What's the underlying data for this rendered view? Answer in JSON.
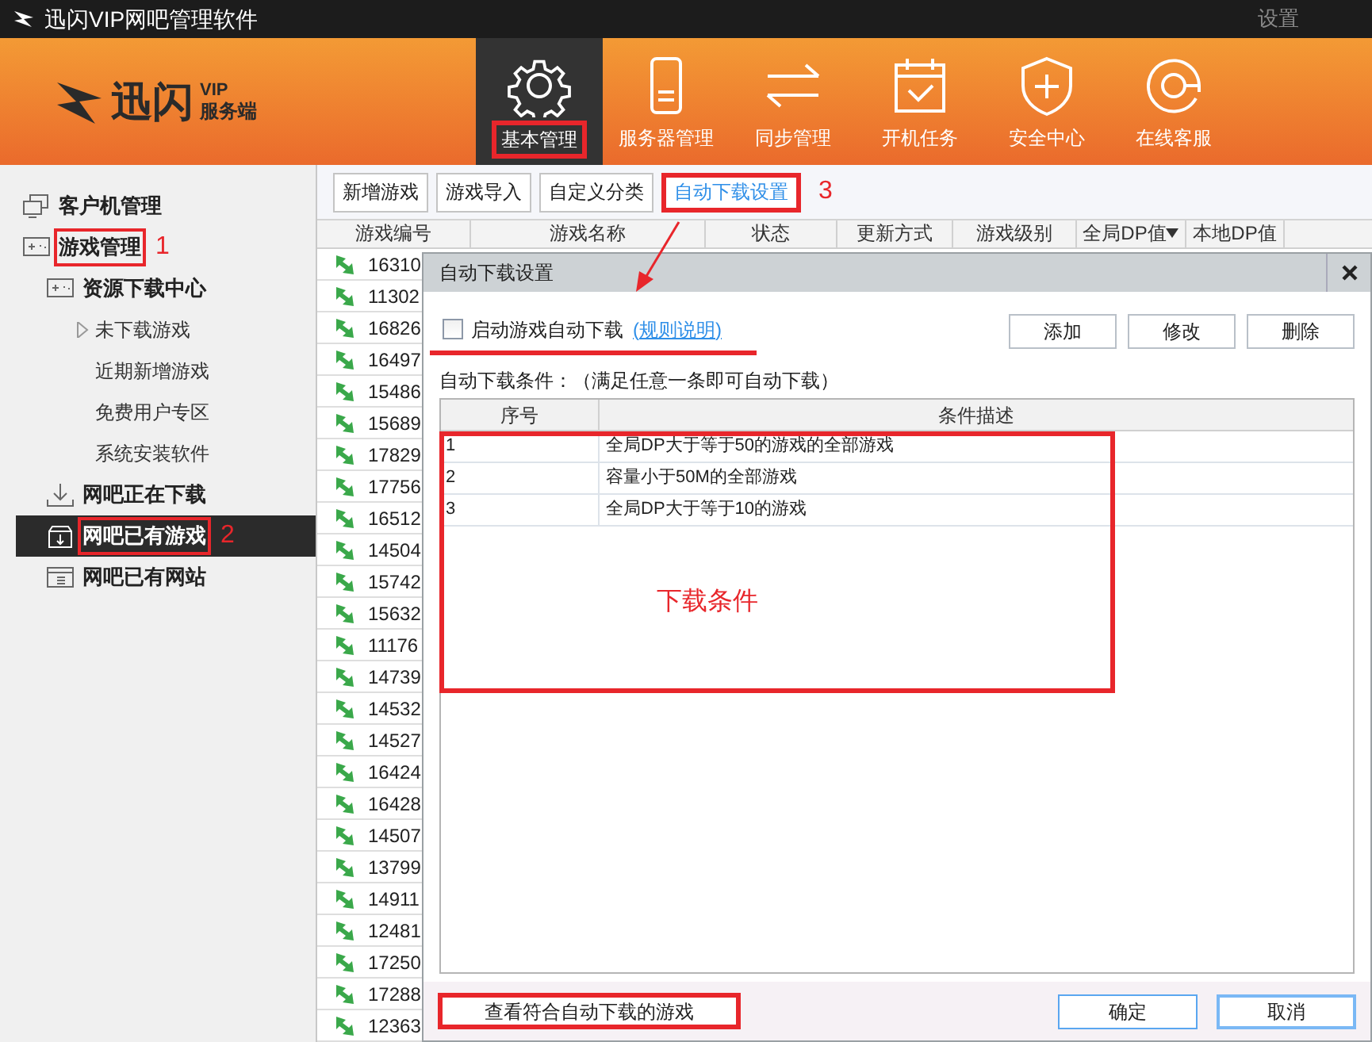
{
  "window": {
    "title": "迅闪VIP网吧管理软件",
    "settings": "设置"
  },
  "logo": {
    "name": "迅闪",
    "badge": "VIP",
    "subtitle": "服务端"
  },
  "nav": [
    {
      "label": "基本管理",
      "selected": true,
      "highlighted": true
    },
    {
      "label": "服务器管理",
      "selected": false,
      "highlighted": false
    },
    {
      "label": "同步管理",
      "selected": false,
      "highlighted": false
    },
    {
      "label": "开机任务",
      "selected": false,
      "highlighted": false
    },
    {
      "label": "安全中心",
      "selected": false,
      "highlighted": false
    },
    {
      "label": "在线客服",
      "selected": false,
      "highlighted": false
    }
  ],
  "sidebar": {
    "items": [
      {
        "label": "客户机管理",
        "kind": "monitors",
        "selected": false,
        "highlighted": false
      },
      {
        "label": "游戏管理",
        "kind": "gamepad",
        "selected": false,
        "highlighted": true,
        "annotation": "1",
        "children": [
          {
            "label": "资源下载中心",
            "kind": "gamepad",
            "selected": false,
            "highlighted": false,
            "children": [
              {
                "label": "未下载游戏",
                "expanded": false,
                "selected": false,
                "highlighted": false
              },
              {
                "label": "近期新增游戏",
                "selected": false,
                "highlighted": false
              },
              {
                "label": "免费用户专区",
                "selected": false,
                "highlighted": false
              },
              {
                "label": "系统安装软件",
                "selected": false,
                "highlighted": false
              }
            ]
          },
          {
            "label": "网吧正在下载",
            "kind": "download",
            "selected": false,
            "highlighted": false
          },
          {
            "label": "网吧已有游戏",
            "kind": "box",
            "selected": true,
            "highlighted": true,
            "annotation": "2"
          },
          {
            "label": "网吧已有网站",
            "kind": "browser",
            "selected": false,
            "highlighted": false
          }
        ]
      }
    ]
  },
  "toolbar": [
    {
      "label": "新增游戏",
      "active": false,
      "highlighted": false
    },
    {
      "label": "游戏导入",
      "active": false,
      "highlighted": false
    },
    {
      "label": "自定义分类",
      "active": false,
      "highlighted": false
    },
    {
      "label": "自动下载设置",
      "active": true,
      "highlighted": true,
      "annotation": "3"
    }
  ],
  "table": {
    "columns": [
      {
        "label": "游戏编号",
        "sorted": false
      },
      {
        "label": "游戏名称",
        "sorted": false
      },
      {
        "label": "状态",
        "sorted": false
      },
      {
        "label": "更新方式",
        "sorted": false
      },
      {
        "label": "游戏级别",
        "sorted": false
      },
      {
        "label": "全局DP值",
        "sorted": true
      },
      {
        "label": "本地DP值",
        "sorted": false
      }
    ],
    "rows": [
      {
        "id": "16310"
      },
      {
        "id": "11302"
      },
      {
        "id": "16826"
      },
      {
        "id": "16497"
      },
      {
        "id": "15486"
      },
      {
        "id": "15689"
      },
      {
        "id": "17829"
      },
      {
        "id": "17756"
      },
      {
        "id": "16512"
      },
      {
        "id": "14504"
      },
      {
        "id": "15742"
      },
      {
        "id": "15632"
      },
      {
        "id": "11176"
      },
      {
        "id": "14739"
      },
      {
        "id": "14532"
      },
      {
        "id": "14527"
      },
      {
        "id": "16424"
      },
      {
        "id": "16428"
      },
      {
        "id": "14507"
      },
      {
        "id": "13799"
      },
      {
        "id": "14911"
      },
      {
        "id": "12481"
      },
      {
        "id": "17250"
      },
      {
        "id": "17288"
      },
      {
        "id": "12363"
      }
    ]
  },
  "dialog": {
    "title": "自动下载设置",
    "auto_download": {
      "label": "启动游戏自动下载",
      "checked": false,
      "link": "(规则说明)",
      "underlined": true
    },
    "buttons": [
      "添加",
      "修改",
      "删除"
    ],
    "conditions_label": "自动下载条件：（满足任意一条即可自动下载）",
    "conditions": {
      "columns": [
        "序号",
        "条件描述"
      ],
      "rows": [
        {
          "index": "1",
          "description": "全局DP大于等于50的游戏的全部游戏"
        },
        {
          "index": "2",
          "description": "容量小于50M的全部游戏"
        },
        {
          "index": "3",
          "description": "全局DP大于等于10的游戏"
        }
      ],
      "highlighted": true,
      "annotation": "下载条件"
    },
    "view_matching": {
      "label": "查看符合自动下载的游戏",
      "highlighted": true
    },
    "ok": "确定",
    "cancel": "取消"
  },
  "annotation_arrow": true
}
